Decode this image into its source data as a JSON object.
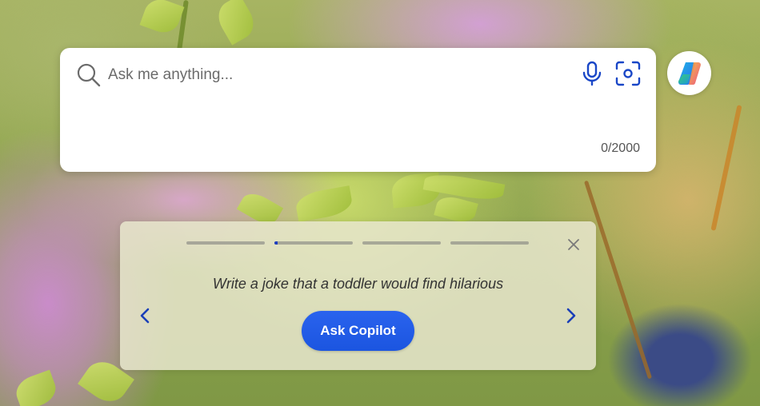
{
  "search": {
    "placeholder": "Ask me anything...",
    "value": "",
    "char_counter": "0/2000",
    "icons": {
      "search": "search-icon",
      "mic": "microphone-icon",
      "visual_search": "visual-search-icon"
    }
  },
  "copilot": {
    "icon": "copilot-logo-icon"
  },
  "suggestion": {
    "text": "Write a joke that a toddler would find hilarious",
    "button_label": "Ask Copilot",
    "steps_total": 4,
    "current_step": 2,
    "current_step_progress": 0.04,
    "icons": {
      "close": "close-icon",
      "prev": "chevron-left-icon",
      "next": "chevron-right-icon"
    }
  },
  "colors": {
    "accent": "#1f55e6",
    "icon_blue": "#1a47c7",
    "card_bg": "#ffffff",
    "panel_bg": "#e8e6cd"
  }
}
